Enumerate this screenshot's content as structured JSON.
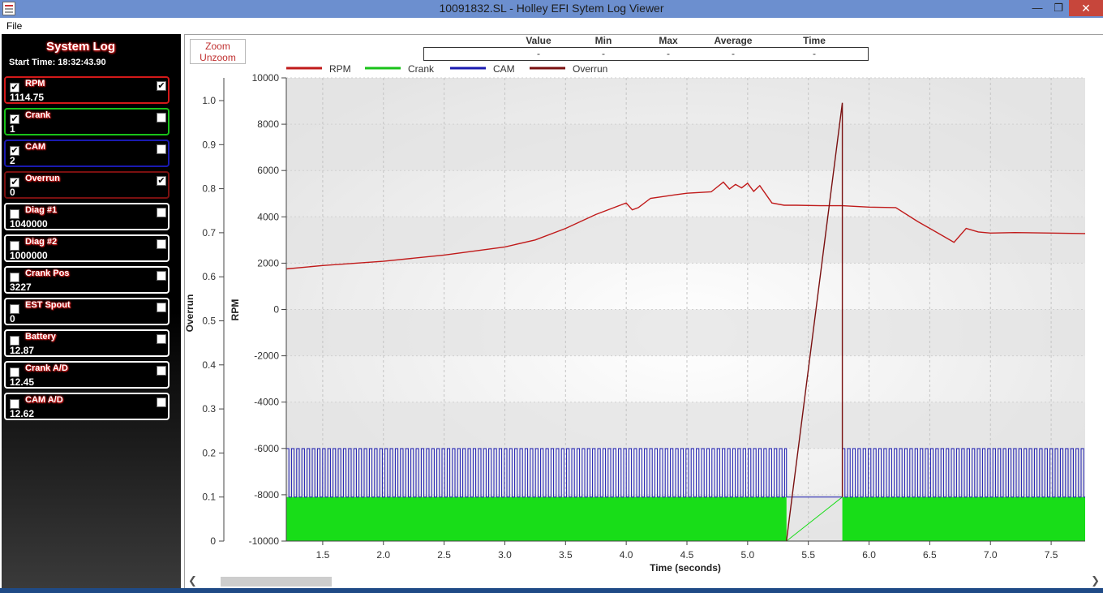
{
  "window": {
    "title": "10091832.SL - Holley EFI Sytem Log Viewer",
    "min": "—",
    "max": "❐",
    "close": "✕"
  },
  "menu": {
    "file": "File"
  },
  "sidebar": {
    "title": "System Log",
    "start_time": "Start Time: 18:32:43.90",
    "channels": [
      {
        "name": "RPM",
        "value": "1114.75",
        "checked": true,
        "plotted": true,
        "color": "#d41919"
      },
      {
        "name": "Crank",
        "value": "1",
        "checked": true,
        "plotted": false,
        "color": "#19c219"
      },
      {
        "name": "CAM",
        "value": "2",
        "checked": true,
        "plotted": false,
        "color": "#1a1ab0"
      },
      {
        "name": "Overrun",
        "value": "0",
        "checked": true,
        "plotted": true,
        "color": "#7a1010"
      },
      {
        "name": "Diag #1",
        "value": "1040000",
        "checked": false,
        "plotted": false,
        "color": "#ffffff"
      },
      {
        "name": "Diag #2",
        "value": "1000000",
        "checked": false,
        "plotted": false,
        "color": "#ffffff"
      },
      {
        "name": "Crank Pos",
        "value": "3227",
        "checked": false,
        "plotted": false,
        "color": "#ffffff"
      },
      {
        "name": "EST Spout",
        "value": "0",
        "checked": false,
        "plotted": false,
        "color": "#ffffff"
      },
      {
        "name": "Battery",
        "value": "12.87",
        "checked": false,
        "plotted": false,
        "color": "#ffffff"
      },
      {
        "name": "Crank A/D",
        "value": "12.45",
        "checked": false,
        "plotted": false,
        "color": "#ffffff"
      },
      {
        "name": "CAM A/D",
        "value": "12.62",
        "checked": false,
        "plotted": false,
        "color": "#ffffff"
      }
    ]
  },
  "toolbar": {
    "zoom": "Zoom",
    "unzoom": "Unzoom"
  },
  "stats": {
    "headers": [
      "Value",
      "Min",
      "Max",
      "Average",
      "Time"
    ],
    "values": [
      "-",
      "-",
      "-",
      "-",
      "-"
    ]
  },
  "chart_data": {
    "type": "line",
    "xlabel": "Time (seconds)",
    "ylabel_left": "Overrun",
    "ylabel_right": "RPM",
    "xlim": [
      1.2,
      7.78
    ],
    "x_ticks": [
      1.5,
      2.0,
      2.5,
      3.0,
      3.5,
      4.0,
      4.5,
      5.0,
      5.5,
      6.0,
      6.5,
      7.0,
      7.5
    ],
    "y_left_lim": [
      0,
      1.05
    ],
    "y_left_ticks": [
      "1.0",
      "0.9",
      "0.8",
      "0.7",
      "0.6",
      "0.5",
      "0.4",
      "0.3",
      "0.2",
      "0.1",
      "0"
    ],
    "y_right_lim": [
      -10000,
      10000
    ],
    "y_right_ticks": [
      "10000",
      "8000",
      "6000",
      "4000",
      "2000",
      "0",
      "-2000",
      "-4000",
      "-6000",
      "-8000",
      "-10000"
    ],
    "legend": [
      "RPM",
      "Crank",
      "CAM",
      "Overrun"
    ],
    "series": [
      {
        "name": "RPM",
        "color": "#c01a1a",
        "x": [
          1.2,
          1.5,
          2.0,
          2.5,
          3.0,
          3.25,
          3.5,
          3.75,
          3.95,
          4.0,
          4.05,
          4.1,
          4.2,
          4.4,
          4.5,
          4.7,
          4.8,
          4.85,
          4.9,
          4.95,
          5.0,
          5.05,
          5.1,
          5.2,
          5.3,
          5.4,
          5.6,
          5.78,
          6.0,
          6.22,
          6.4,
          6.6,
          6.7,
          6.8,
          6.9,
          7.0,
          7.2,
          7.5,
          7.78
        ],
        "y": [
          1750,
          1900,
          2080,
          2350,
          2700,
          3000,
          3500,
          4100,
          4500,
          4600,
          4300,
          4400,
          4800,
          4950,
          5020,
          5080,
          5500,
          5200,
          5400,
          5250,
          5450,
          5100,
          5350,
          4600,
          4500,
          4500,
          4480,
          4480,
          4420,
          4400,
          3800,
          3200,
          2900,
          3500,
          3350,
          3300,
          3320,
          3300,
          3280
        ]
      },
      {
        "name": "Overrun",
        "color": "#7a1010",
        "x": [
          5.32,
          5.78,
          5.78
        ],
        "y": [
          0,
          0.995,
          0.1
        ]
      },
      {
        "name": "Crank",
        "color": "#18dd18",
        "fill_to": 0.1,
        "segments": [
          [
            1.2,
            5.32
          ],
          [
            5.78,
            7.78
          ]
        ],
        "ramp": [
          [
            5.32,
            0
          ],
          [
            5.78,
            0.1
          ]
        ]
      },
      {
        "name": "CAM",
        "color": "#1a1ab0",
        "low": 0.1,
        "high": 0.21,
        "segments": [
          [
            1.2,
            5.32
          ],
          [
            5.78,
            7.78
          ]
        ]
      }
    ]
  }
}
